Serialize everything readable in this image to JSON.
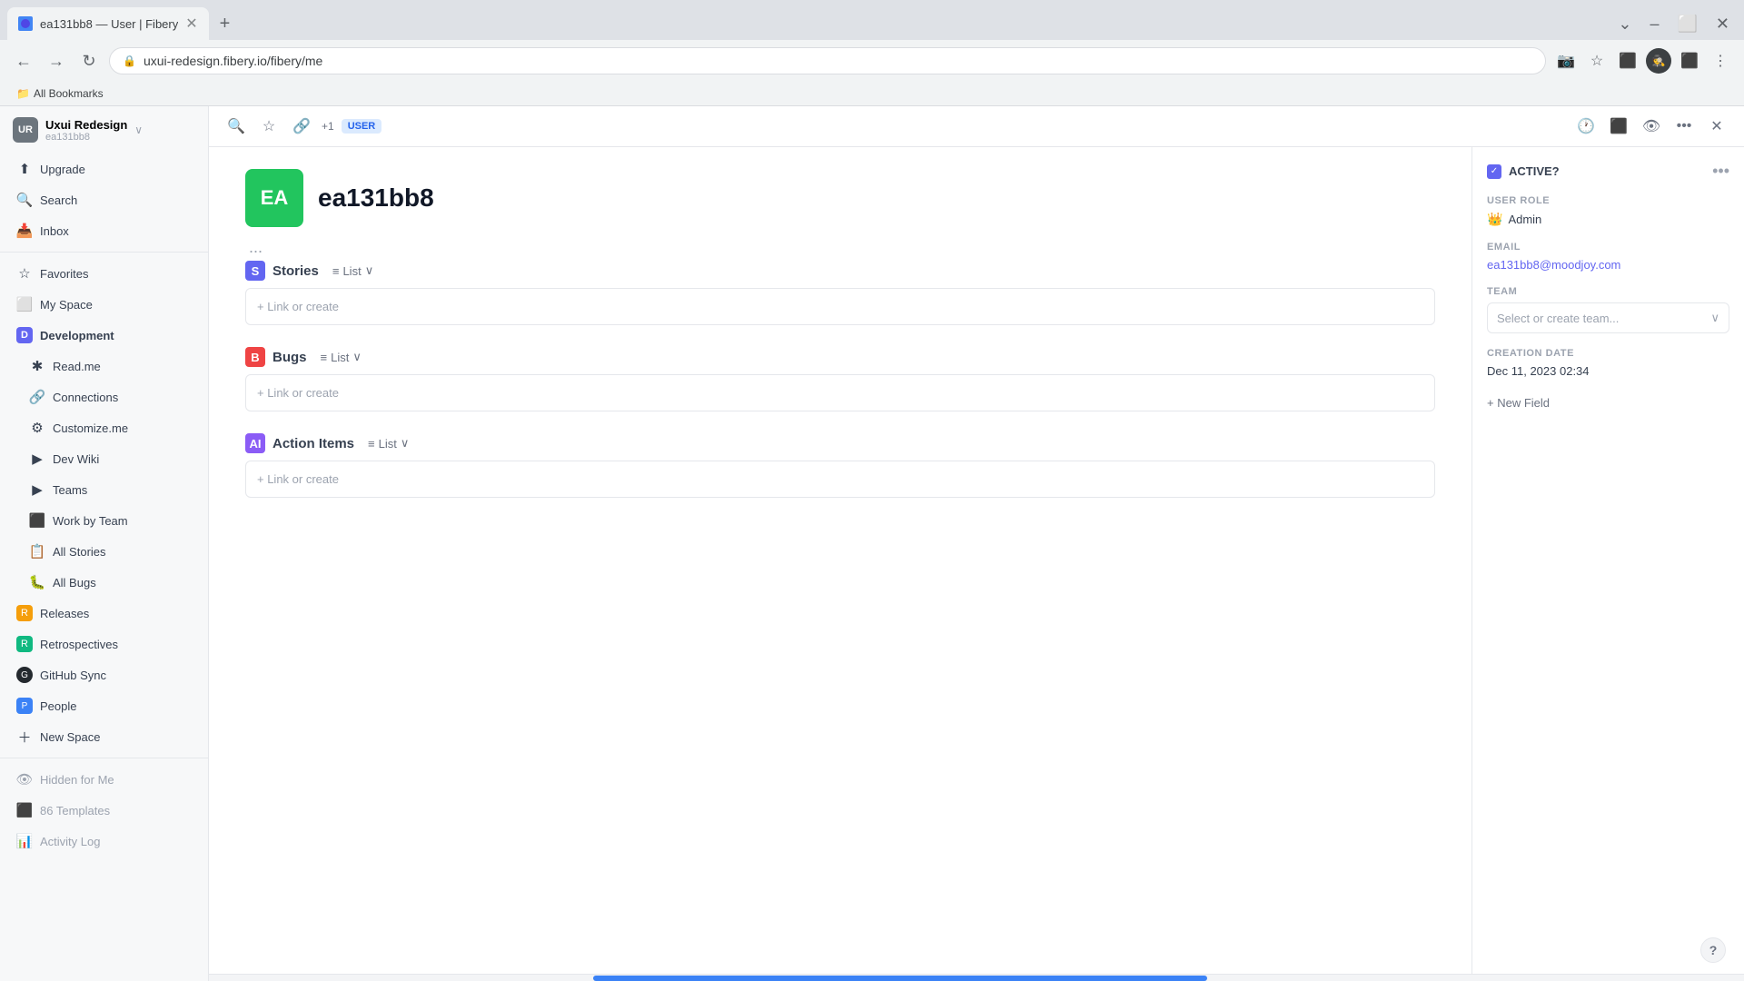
{
  "browser": {
    "tab_title": "ea131bb8 — User | Fibery",
    "url": "uxui-redesign.fibery.io/fibery/me",
    "incognito_label": "Incognito",
    "bookmarks_bar_item": "All Bookmarks"
  },
  "workspace": {
    "name": "Uxui Redesign",
    "subtitle": "ea131bb8",
    "avatar_initials": "UR"
  },
  "sidebar": {
    "nav_items": [
      {
        "label": "Upgrade",
        "icon": "⬆"
      },
      {
        "label": "Search",
        "icon": "🔍"
      },
      {
        "label": "Inbox",
        "icon": "📥"
      }
    ],
    "favorites_label": "Favorites",
    "my_space_label": "My Space",
    "development_label": "Development",
    "dev_items": [
      {
        "label": "Read.me",
        "icon": "📄"
      },
      {
        "label": "Connections",
        "icon": "🔗"
      },
      {
        "label": "Customize.me",
        "icon": "⚙"
      },
      {
        "label": "Dev Wiki",
        "icon": "📝"
      },
      {
        "label": "Teams",
        "icon": "👥"
      },
      {
        "label": "Work by Team",
        "icon": "⬛"
      },
      {
        "label": "All Stories",
        "icon": "📋"
      },
      {
        "label": "All Bugs",
        "icon": "🐛"
      }
    ],
    "releases_label": "Releases",
    "retrospectives_label": "Retrospectives",
    "github_sync_label": "GitHub Sync",
    "people_label": "People",
    "new_space_label": "New Space",
    "hidden_label": "Hidden for Me",
    "templates_label": "Templates",
    "templates_count": "86 Templates",
    "activity_log_label": "Activity Log"
  },
  "toolbar": {
    "tag_label": "USER",
    "link_count": "+1"
  },
  "document": {
    "user_initials": "EA",
    "user_name": "ea131bb8",
    "more_label": "...",
    "sections": [
      {
        "id": "stories",
        "icon_label": "S",
        "icon_color": "stories",
        "title": "Stories",
        "view": "List",
        "link_or_create": "+ Link or create"
      },
      {
        "id": "bugs",
        "icon_label": "B",
        "icon_color": "bugs",
        "title": "Bugs",
        "view": "List",
        "link_or_create": "+ Link or create"
      },
      {
        "id": "action",
        "icon_label": "AI",
        "icon_color": "action",
        "title": "Action Items",
        "view": "List",
        "link_or_create": "+ Link or create"
      }
    ]
  },
  "right_panel": {
    "active_label": "ACTIVE?",
    "active_checked": true,
    "user_role_label": "USER ROLE",
    "user_role_value": "Admin",
    "email_label": "EMAIL",
    "email_value": "ea131bb8@moodjoy.com",
    "team_label": "TEAM",
    "team_placeholder": "Select or create team...",
    "creation_date_label": "CREATION DATE",
    "creation_date_value": "Dec 11, 2023 02:34",
    "new_field_label": "+ New Field"
  },
  "help_btn": "?"
}
